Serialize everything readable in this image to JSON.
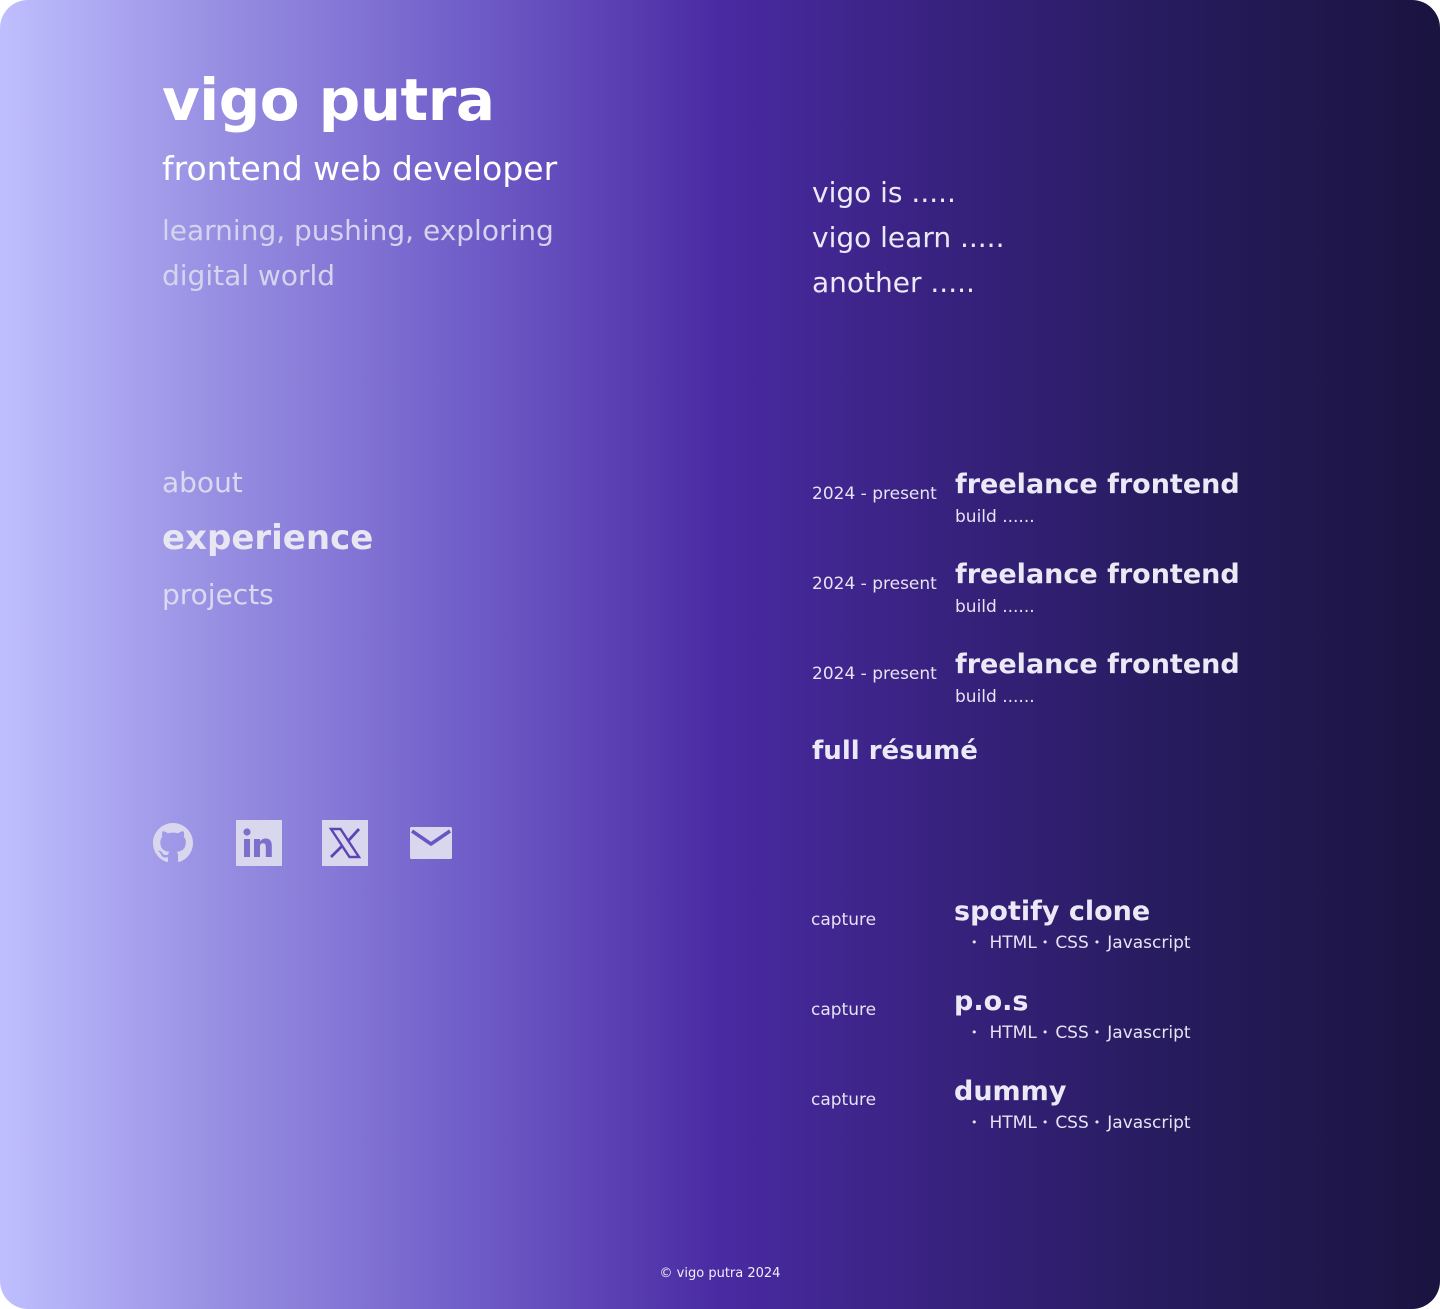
{
  "profile": {
    "name": "vigo putra",
    "role": "frontend web developer",
    "tagline": "learning, pushing, exploring digital world"
  },
  "nav": {
    "items": [
      {
        "label": "about",
        "active": false
      },
      {
        "label": "experience",
        "active": true
      },
      {
        "label": "projects",
        "active": false
      }
    ]
  },
  "socials": [
    {
      "name": "github",
      "icon": "github-icon"
    },
    {
      "name": "linkedin",
      "icon": "linkedin-icon"
    },
    {
      "name": "x",
      "icon": "x-icon"
    },
    {
      "name": "email",
      "icon": "mail-icon"
    }
  ],
  "about": {
    "lines": [
      "vigo is .....",
      "vigo learn .....",
      "another ....."
    ]
  },
  "experience": {
    "items": [
      {
        "date": "2024 - present",
        "title": "freelance frontend",
        "desc": "build ......"
      },
      {
        "date": "2024 - present",
        "title": "freelance frontend",
        "desc": "build ......"
      },
      {
        "date": "2024 - present",
        "title": "freelance frontend",
        "desc": "build ......"
      }
    ],
    "resume_label": "full résumé"
  },
  "projects": {
    "items": [
      {
        "capture": "capture",
        "title": "spotify clone",
        "tags": [
          "HTML",
          "CSS",
          "Javascript"
        ]
      },
      {
        "capture": "capture",
        "title": "p.o.s",
        "tags": [
          "HTML",
          "CSS",
          "Javascript"
        ]
      },
      {
        "capture": "capture",
        "title": "dummy",
        "tags": [
          "HTML",
          "CSS",
          "Javascript"
        ]
      }
    ]
  },
  "footer": {
    "copyright": "© vigo putra 2024"
  },
  "colors": {
    "gradient_start": "#bfbfff",
    "gradient_mid": "#4a2aa2",
    "gradient_end": "#1a1440",
    "text": "#e9e6f5",
    "icon": "#d9d7ee"
  }
}
